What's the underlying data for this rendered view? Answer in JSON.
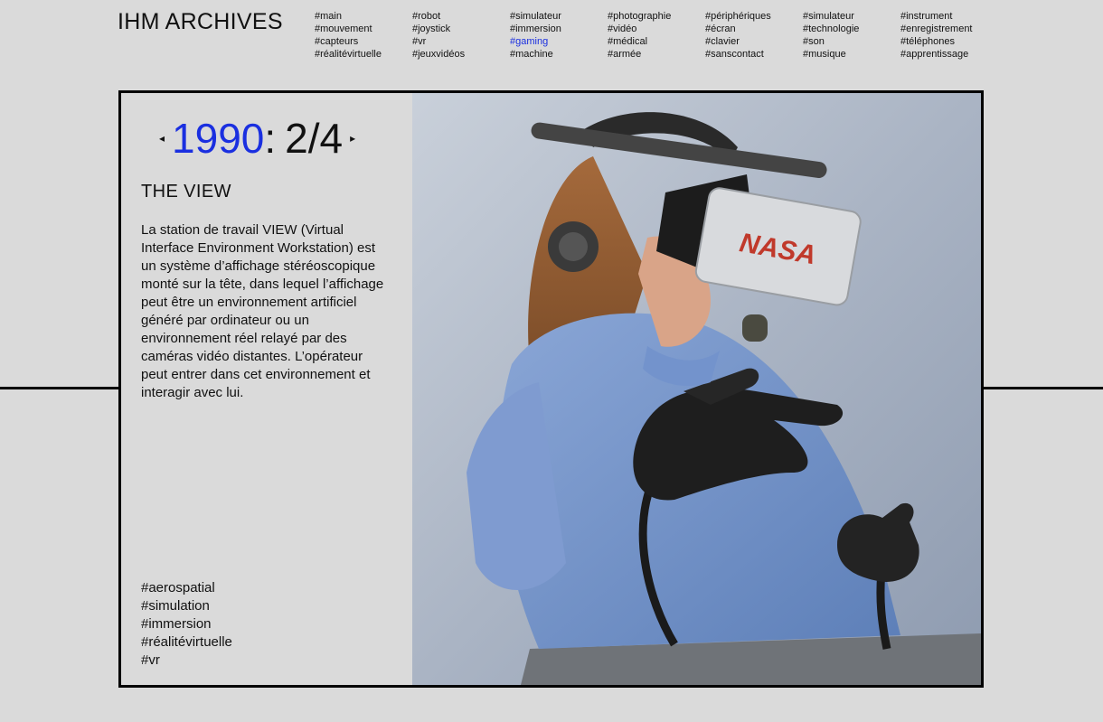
{
  "header": {
    "title": "IHM ARCHIVES",
    "tag_columns": [
      [
        "#main",
        "#mouvement",
        "#capteurs",
        "#réalitévirtuelle"
      ],
      [
        "#robot",
        "#joystick",
        "#vr",
        "#jeuxvidéos"
      ],
      [
        "#simulateur",
        "#immersion",
        "#gaming",
        "#machine"
      ],
      [
        "#photographie",
        "#vidéo",
        "#médical",
        "#armée"
      ],
      [
        "#périphériques",
        "#écran",
        "#clavier",
        "#sanscontact"
      ],
      [
        "#simulateur",
        "#technologie",
        "#son",
        "#musique"
      ],
      [
        "#instrument",
        "#enregistrement",
        "#téléphones",
        "#apprentissage"
      ]
    ],
    "active_tag": "#gaming"
  },
  "card": {
    "year": "1990",
    "separator": ":",
    "counter": "2/4",
    "prev_arrow": "◂",
    "next_arrow": "▸",
    "title": "THE VIEW",
    "description": "La station de travail VIEW (Virtual Interface Environment Workstation) est un système d’affichage stéréoscopique monté sur la tête, dans lequel l’affichage peut être un environnement artificiel généré par ordinateur ou un environnement réel relayé par des caméras vidéo distantes. L’opérateur peut entrer dans cet environnement et interagir avec lui.",
    "tags": [
      "#aerospatial",
      "#simulation",
      "#immersion",
      "#réalitévirtuelle",
      "#vr"
    ],
    "photo": {
      "subject": "woman wearing NASA VR headset and data gloves",
      "headset_label": "NASA"
    }
  },
  "colors": {
    "background": "#dadada",
    "accent": "#1a2fe0",
    "text": "#111111",
    "border": "#000000"
  }
}
